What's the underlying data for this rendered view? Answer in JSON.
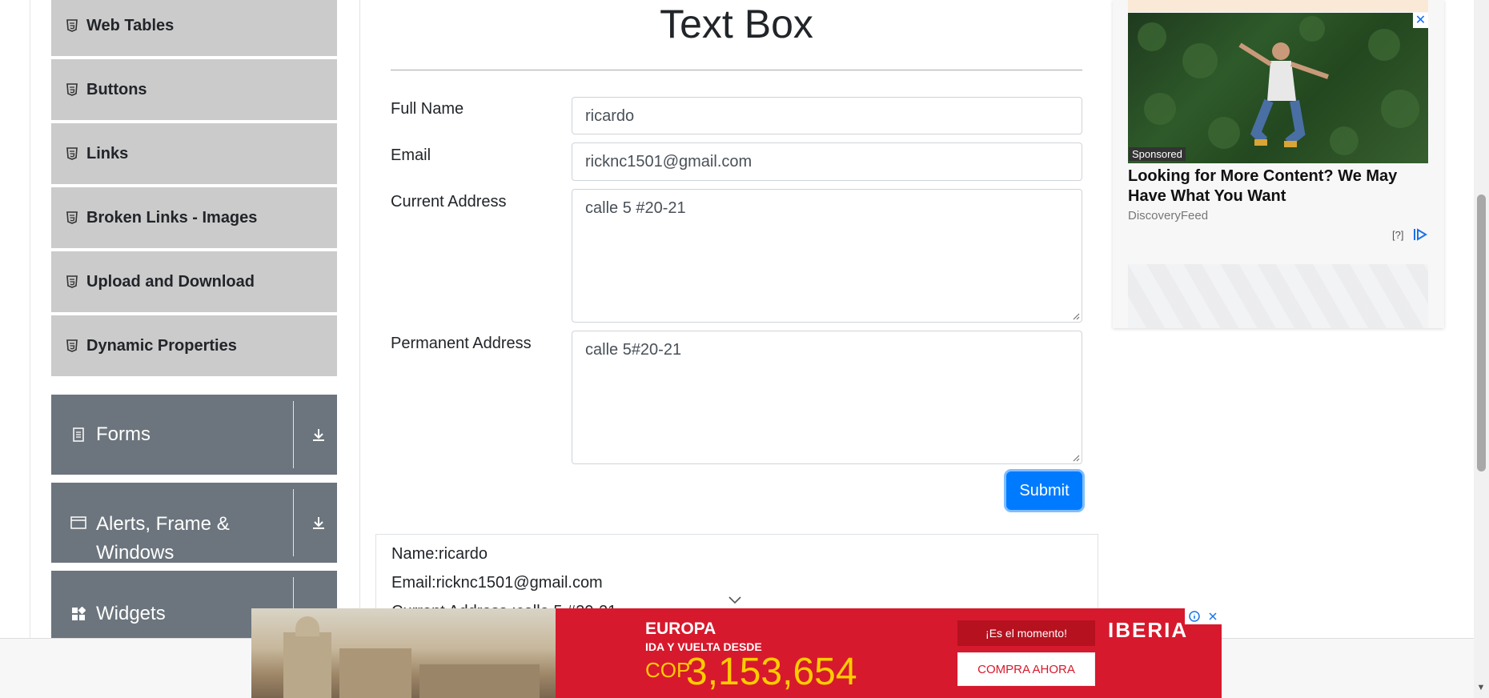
{
  "sidebar": {
    "items": [
      {
        "label": "Web Tables"
      },
      {
        "label": "Buttons"
      },
      {
        "label": "Links"
      },
      {
        "label": "Broken Links - Images"
      },
      {
        "label": "Upload and Download"
      },
      {
        "label": "Dynamic Properties"
      }
    ],
    "groups": [
      {
        "label": "Forms",
        "icon": "document-icon"
      },
      {
        "label": "Alerts, Frame & Windows",
        "icon": "window-icon"
      },
      {
        "label": "Widgets",
        "icon": "widgets-grid-icon"
      }
    ]
  },
  "main": {
    "title": "Text Box",
    "form": {
      "full_name_label": "Full Name",
      "full_name_value": "ricardo",
      "email_label": "Email",
      "email_value": "ricknc1501@gmail.com",
      "current_address_label": "Current Address",
      "current_address_value": "calle 5 #20-21",
      "permanent_address_label": "Permanent Address",
      "permanent_address_value": "calle 5#20-21",
      "submit_label": "Submit"
    },
    "output": {
      "name": "Name:ricardo",
      "email": "Email:ricknc1501@gmail.com",
      "current_address": "Current Address :calle 5 #20-21"
    }
  },
  "ad": {
    "sponsored": "Sponsored",
    "headline": "Looking for More Content? We May Have What You Want",
    "source": "DiscoveryFeed",
    "info": "[?]"
  },
  "banner": {
    "destination": "EUROPA",
    "subtitle": "IDA Y VUELTA DESDE",
    "currency": "COP",
    "price": "3,153,654",
    "moment": "¡Es el momento!",
    "cta": "COMPRA AHORA",
    "brand": "IBERIA"
  },
  "colors": {
    "sidebar_item_bg": "#cbcbcb",
    "group_bg": "#6c757d",
    "submit_bg": "#007bff",
    "banner_bg": "#d7192d",
    "price_color": "#ffcc00"
  }
}
